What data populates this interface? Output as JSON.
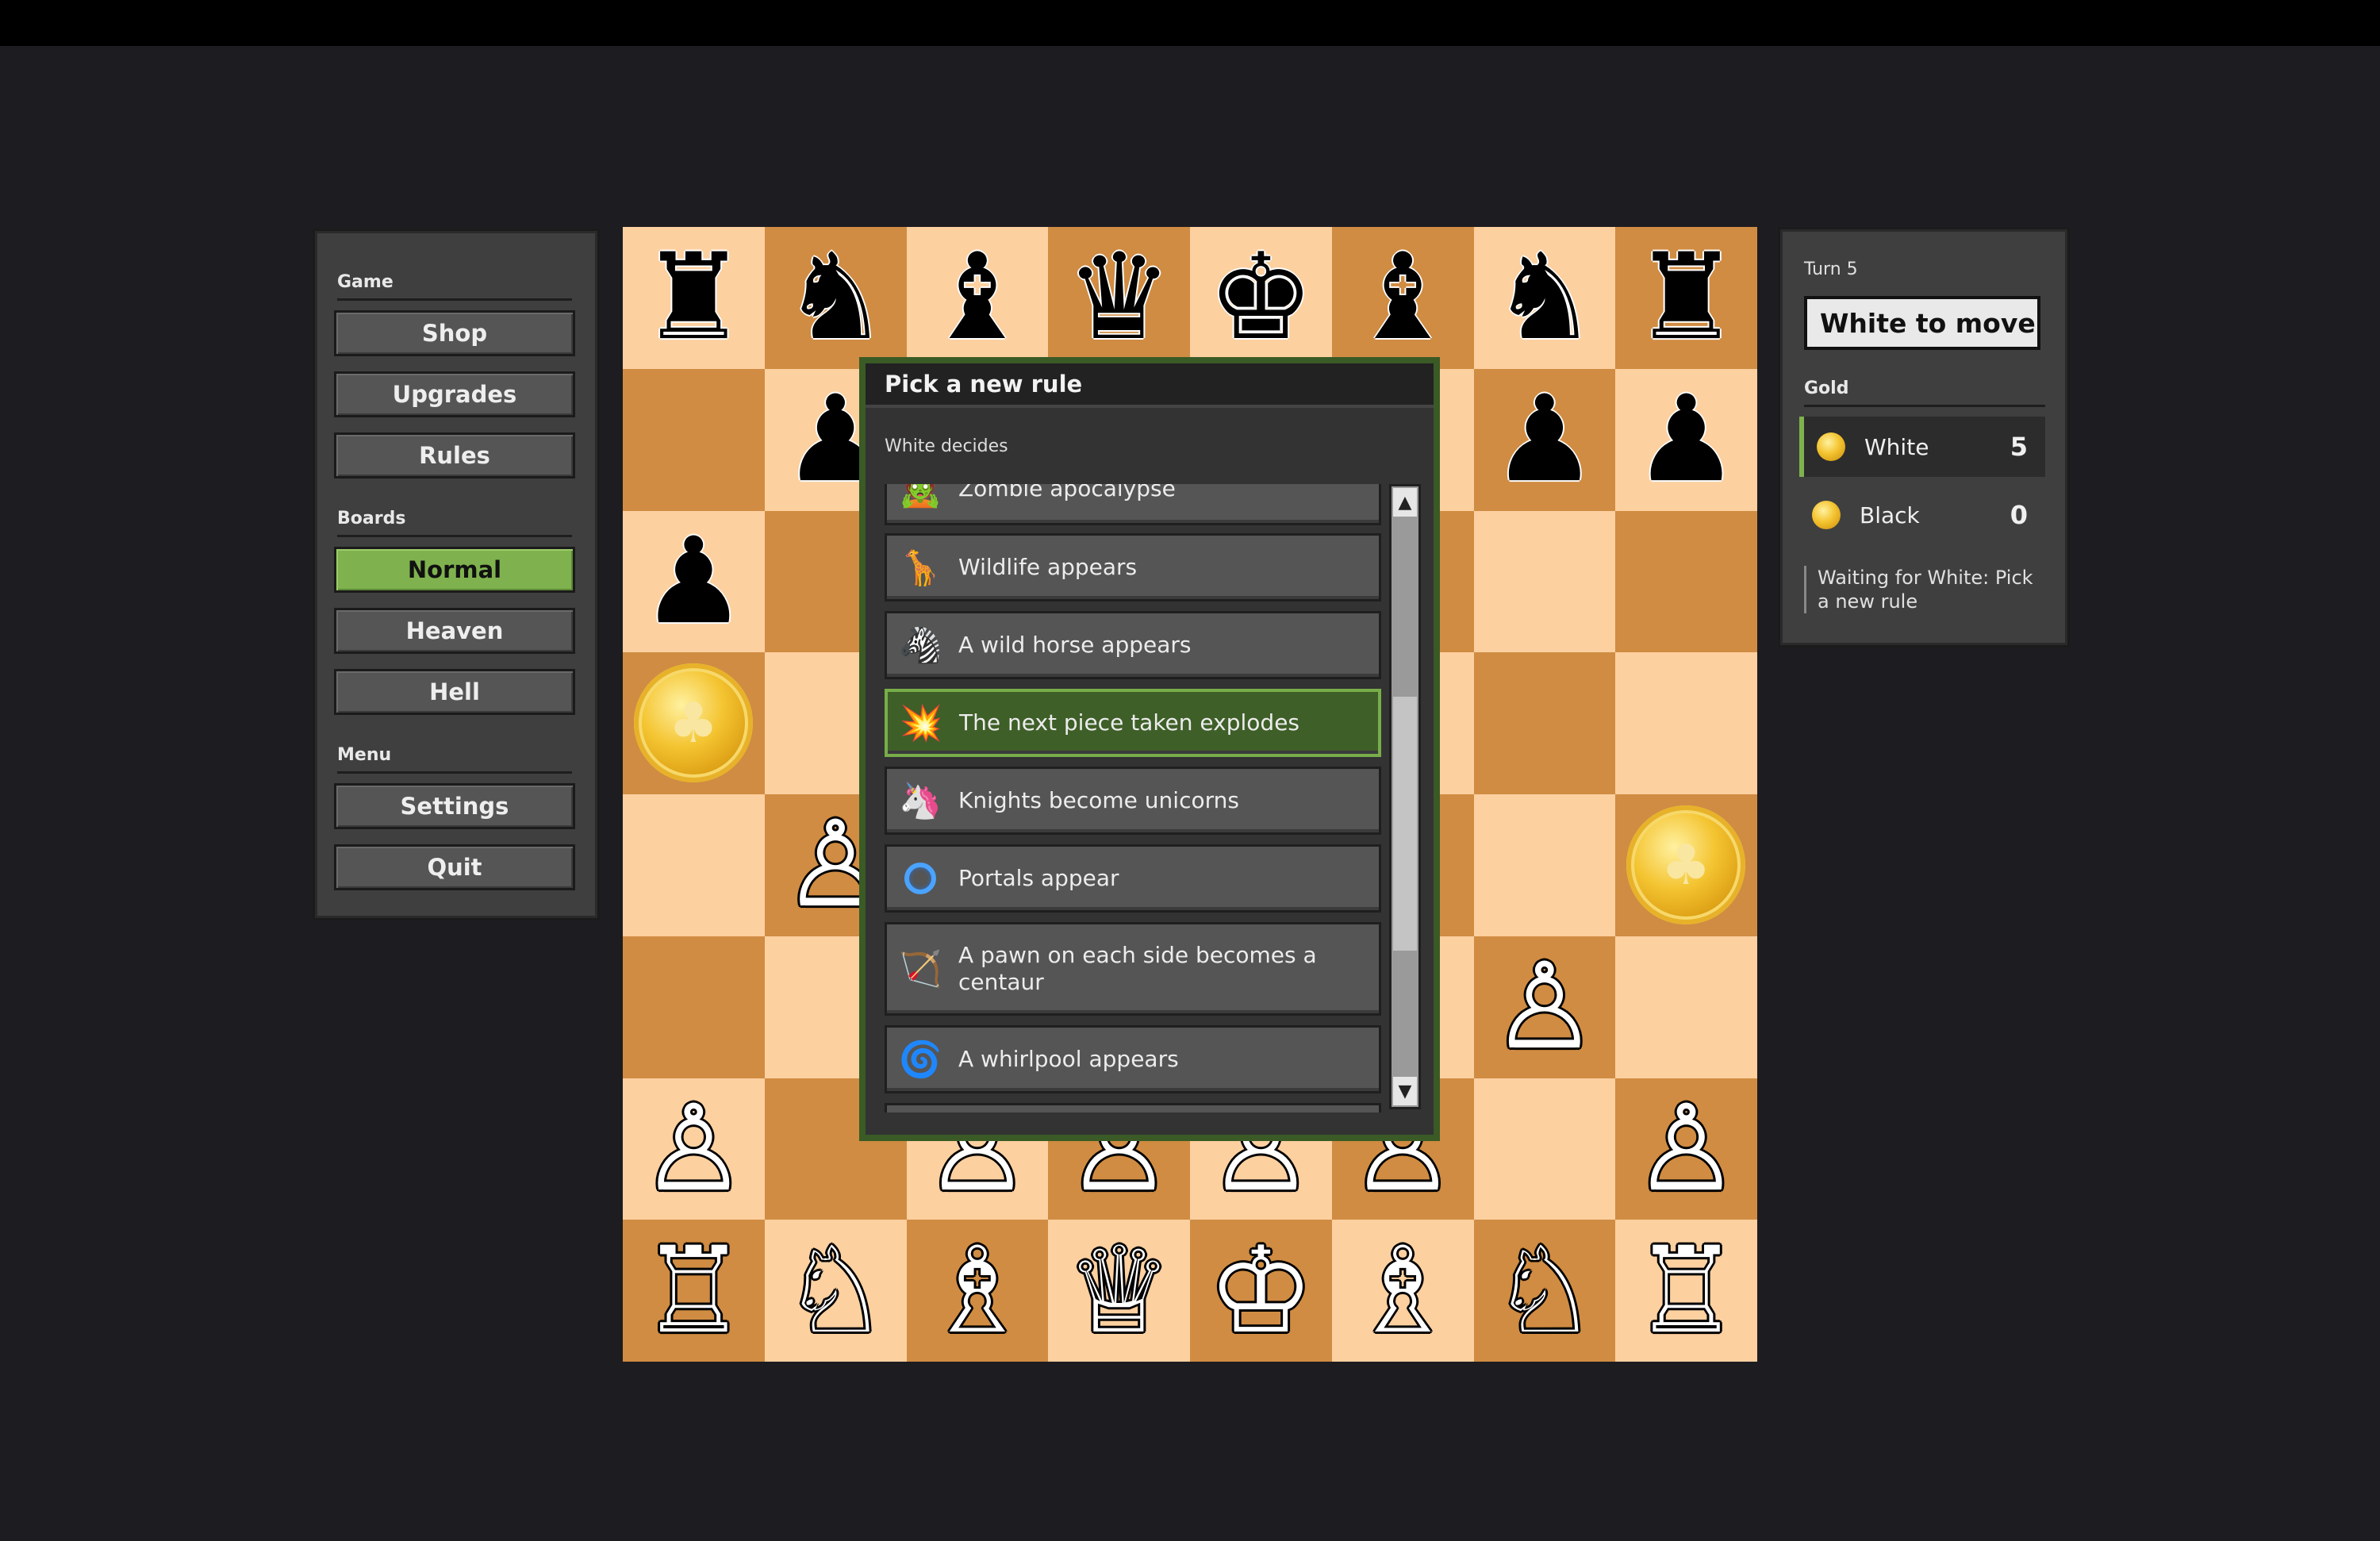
{
  "left_panel": {
    "game_label": "Game",
    "shop": "Shop",
    "upgrades": "Upgrades",
    "rules": "Rules",
    "boards_label": "Boards",
    "normal": "Normal",
    "heaven": "Heaven",
    "hell": "Hell",
    "menu_label": "Menu",
    "settings": "Settings",
    "quit": "Quit"
  },
  "modal": {
    "title": "Pick a new rule",
    "subtitle": "White decides",
    "rules": [
      "Zombie apocalypse",
      "Wildlife appears",
      "A wild horse appears",
      "The next piece taken explodes",
      "Knights become unicorns",
      "Portals appear",
      "A pawn on each side becomes a centaur",
      "A whirlpool appears"
    ],
    "selected_rule": "The next piece taken explodes"
  },
  "right_panel": {
    "turn": "Turn 5",
    "to_move": "White to move",
    "gold_label": "Gold",
    "white_name": "White",
    "white_gold": "5",
    "black_name": "Black",
    "black_gold": "0",
    "status": "Waiting for White: Pick a new rule"
  },
  "colors": {
    "light_square": "#fdd0a0",
    "dark_square": "#d08c42",
    "accent_green": "#7fb24e",
    "modal_border": "#3a5a26"
  }
}
